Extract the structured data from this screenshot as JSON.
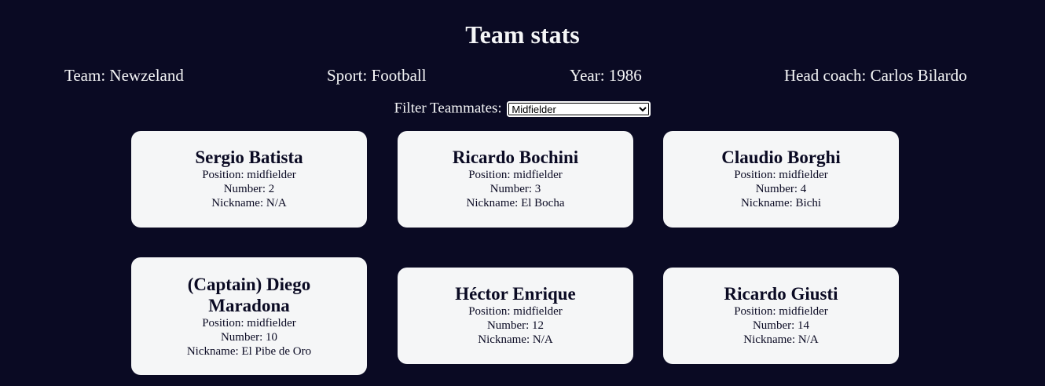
{
  "header": {
    "title": "Team stats"
  },
  "team_info": {
    "team": "Team: Newzeland",
    "sport": "Sport: Football",
    "year": "Year: 1986",
    "head_coach": "Head coach: Carlos Bilardo"
  },
  "filter": {
    "label": "Filter Teammates:",
    "selected": "Midfielder"
  },
  "players": [
    {
      "name": "Sergio Batista",
      "position": "Position: midfielder",
      "number": "Number: 2",
      "nickname": "Nickname: N/A"
    },
    {
      "name": "Ricardo Bochini",
      "position": "Position: midfielder",
      "number": "Number: 3",
      "nickname": "Nickname: El Bocha"
    },
    {
      "name": "Claudio Borghi",
      "position": "Position: midfielder",
      "number": "Number: 4",
      "nickname": "Nickname: Bichi"
    },
    {
      "name": "(Captain) Diego Maradona",
      "position": "Position: midfielder",
      "number": "Number: 10",
      "nickname": "Nickname: El Pibe de Oro"
    },
    {
      "name": "Héctor Enrique",
      "position": "Position: midfielder",
      "number": "Number: 12",
      "nickname": "Nickname: N/A"
    },
    {
      "name": "Ricardo Giusti",
      "position": "Position: midfielder",
      "number": "Number: 14",
      "nickname": "Nickname: N/A"
    }
  ]
}
